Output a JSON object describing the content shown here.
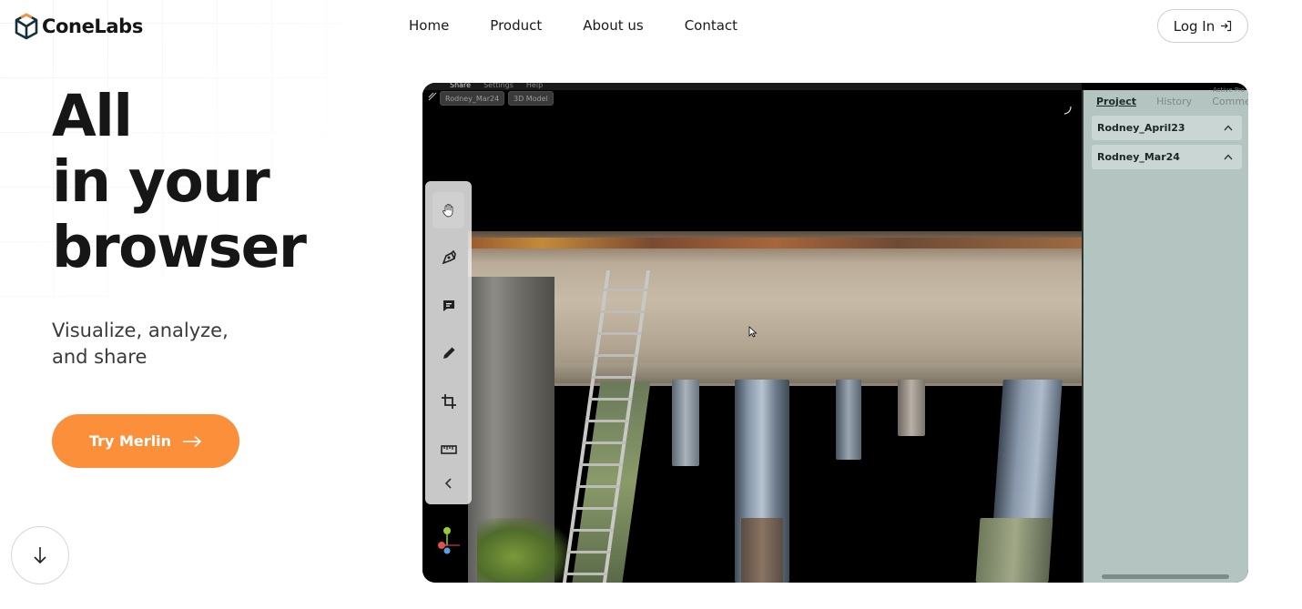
{
  "brand": {
    "name": "ConeLabs",
    "icon": "cube-logo-icon",
    "accent": "#fb8f3a"
  },
  "nav": {
    "items": [
      {
        "label": "Home"
      },
      {
        "label": "Product"
      },
      {
        "label": "About us"
      },
      {
        "label": "Contact"
      }
    ],
    "login_label": "Log In",
    "login_icon": "login-arrow-icon"
  },
  "hero": {
    "title_lines": [
      "All",
      "in your",
      "browser"
    ],
    "subtitle_lines": [
      "Visualize, analyze,",
      "and share"
    ],
    "cta_label": "Try Merlin",
    "cta_icon": "arrow-right-icon",
    "scroll_icon": "arrow-down-icon"
  },
  "app_preview": {
    "menu": [
      "Share",
      "Settings",
      "Help"
    ],
    "active_menu": "Share",
    "status_label": "Active Pro",
    "chips": [
      "Rodney_Mar24",
      "3D Model"
    ],
    "tools": [
      {
        "icon": "hand-pan-icon",
        "active": true
      },
      {
        "icon": "pen-tool-icon",
        "active": false
      },
      {
        "icon": "comment-icon",
        "active": false
      },
      {
        "icon": "pencil-icon",
        "active": false
      },
      {
        "icon": "crop-icon",
        "active": false
      },
      {
        "icon": "ruler-icon",
        "active": false
      },
      {
        "icon": "chevron-left-icon",
        "active": false
      }
    ],
    "panel_tabs": [
      "Project",
      "History",
      "Comment"
    ],
    "active_panel_tab": "Project",
    "projects": [
      "Rodney_April23",
      "Rodney_Mar24"
    ]
  }
}
